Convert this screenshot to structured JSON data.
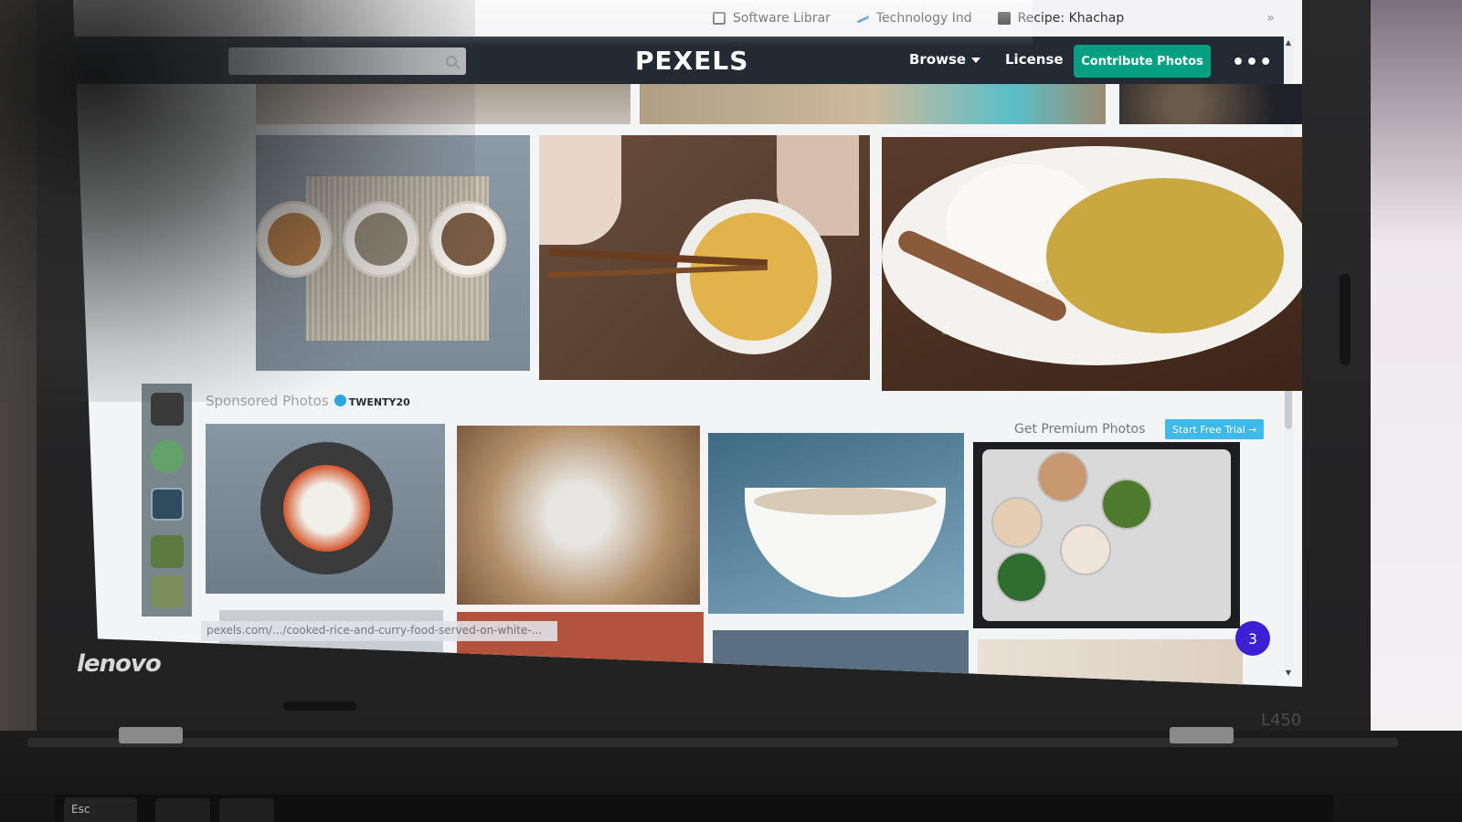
{
  "bookmarks": {
    "items": [
      {
        "label": "Software Librar",
        "icon": "document-icon"
      },
      {
        "label": "Technology Ind",
        "icon": "tech-icon"
      },
      {
        "label": "Recipe: Khachap",
        "icon": "recipe-icon"
      }
    ],
    "more": "»"
  },
  "header": {
    "logo": "PEXELS",
    "browse_label": "Browse",
    "license_label": "License",
    "contribute_label": "Contribute Photos",
    "more_label": "•••",
    "search_placeholder": ""
  },
  "gallery": {
    "sponsored_label": "Sponsored Photos",
    "sponsor_brand": "TWENTY20",
    "premium_label": "Get Premium Photos",
    "trial_label": "Start Free Trial →"
  },
  "status": {
    "url": "pexels.com/.../cooked-rice-and-curry-food-served-on-white-..."
  },
  "notification": {
    "count": "3"
  },
  "device": {
    "brand": "lenovo",
    "model": "L450",
    "esc_key": "Esc"
  },
  "colors": {
    "nav_bg": "#232a34",
    "contribute_bg": "#05a081",
    "trial_bg": "#3fb9ea",
    "badge_bg": "#3d1fd6"
  }
}
